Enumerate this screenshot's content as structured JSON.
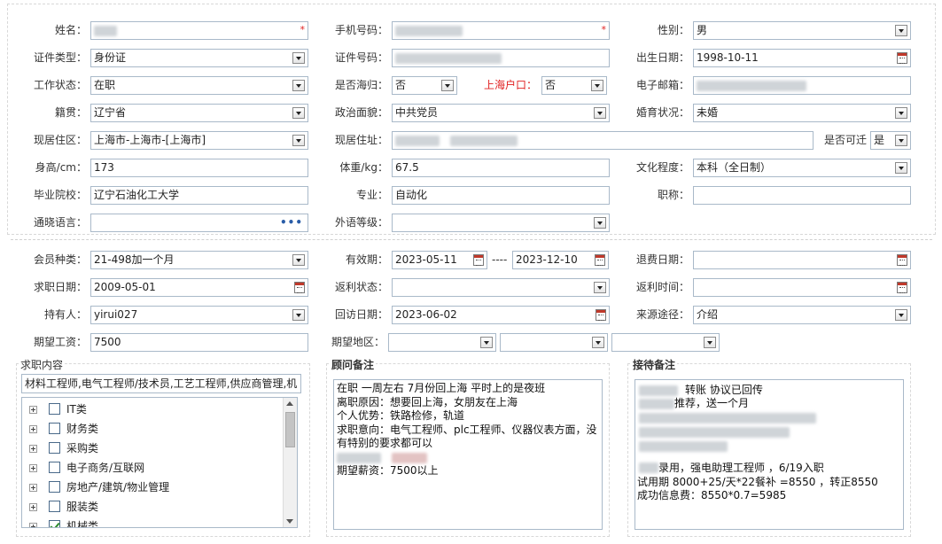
{
  "basic": {
    "name_label": "姓名：",
    "phone_label": "手机号码：",
    "gender_label": "性别：",
    "gender_value": "男",
    "id_type_label": "证件类型：",
    "id_type_value": "身份证",
    "id_no_label": "证件号码：",
    "birth_label": "出生日期：",
    "birth_value": "1998-10-11",
    "work_status_label": "工作状态：",
    "work_status_value": "在职",
    "overseas_label": "是否海归：",
    "overseas_value": "否",
    "shanghai_hukou_label": "上海户口：",
    "shanghai_hukou_value": "否",
    "email_label": "电子邮箱：",
    "native_label": "籍贯：",
    "native_value": "辽宁省",
    "political_label": "政治面貌：",
    "political_value": "中共党员",
    "marital_label": "婚育状况：",
    "marital_value": "未婚",
    "residence_area_label": "现居住区：",
    "residence_area_value": "上海市-上海市-[上海市]",
    "residence_addr_label": "现居住址：",
    "relocate_label": "是否可迁",
    "relocate_value": "是",
    "height_label": "身高/cm：",
    "height_value": "173",
    "weight_label": "体重/kg：",
    "weight_value": "67.5",
    "education_label": "文化程度：",
    "education_value": "本科（全日制）",
    "school_label": "毕业院校：",
    "school_value": "辽宁石油化工大学",
    "major_label": "专业：",
    "major_value": "自动化",
    "title_label": "职称：",
    "language_label": "通晓语言：",
    "language_dots": "•••",
    "foreign_level_label": "外语等级："
  },
  "member": {
    "type_label": "会员种类：",
    "type_value": "21-498加一个月",
    "valid_label": "有效期：",
    "valid_from": "2023-05-11",
    "valid_sep": "----",
    "valid_to": "2023-12-10",
    "refund_date_label": "退费日期：",
    "job_date_label": "求职日期：",
    "job_date_value": "2009-05-01",
    "rebate_status_label": "返利状态：",
    "rebate_time_label": "返利时间：",
    "holder_label": "持有人：",
    "holder_value": "yirui027",
    "revisit_label": "回访日期：",
    "revisit_value": "2023-06-02",
    "source_label": "来源途径：",
    "source_value": "介绍",
    "salary_label": "期望工资：",
    "salary_value": "7500",
    "region_label": "期望地区："
  },
  "job_content": {
    "title": "求职内容",
    "summary": "材料工程师,电气工程师/技术员,工艺工程师,供应商管理,机",
    "tree": [
      {
        "label": "IT类",
        "checked": false
      },
      {
        "label": "财务类",
        "checked": false
      },
      {
        "label": "采购类",
        "checked": false
      },
      {
        "label": "电子商务/互联网",
        "checked": false
      },
      {
        "label": "房地产/建筑/物业管理",
        "checked": false
      },
      {
        "label": "服装类",
        "checked": false
      },
      {
        "label": "机械类",
        "checked": true
      }
    ]
  },
  "consultant_note": {
    "title": "顾问备注",
    "lines": [
      "在职  一周左右 7月份回上海   平时上的是夜班",
      "离职原因：想要回上海，女朋友在上海",
      "个人优势：铁路检修，轨道",
      "求职意向：电气工程师、plc工程师、仪器仪表方面，没",
      "有特别的要求都可以",
      "",
      "期望薪资：7500以上"
    ]
  },
  "reception_note": {
    "title": "接待备注",
    "line1": "转账   协议已回传",
    "line2": "推荐，送一个月",
    "line3": "录用，强电助理工程师 ，6/19入职",
    "line4": "试用期 8000+25/天*22餐补 =8550 ，转正8550",
    "line5": "成功信息费：8550*0.7=5985"
  },
  "colors": {
    "required": "#e02020",
    "border": "#a9b9c9"
  }
}
